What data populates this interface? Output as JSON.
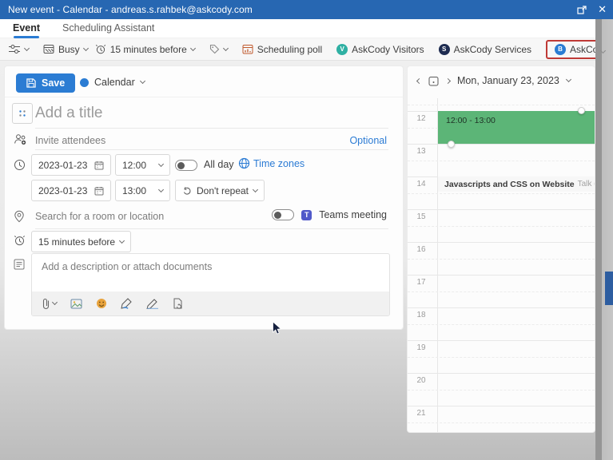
{
  "titlebar": {
    "title": "New event - Calendar - andreas.s.rahbek@askcody.com"
  },
  "tabs": {
    "event": "Event",
    "scheduling_assistant": "Scheduling Assistant"
  },
  "toolbar": {
    "busy": "Busy",
    "reminder": "15 minutes before",
    "scheduling_poll": "Scheduling poll",
    "visitors": "AskCody Visitors",
    "visitors_initial": "V",
    "services": "AskCody Services",
    "services_initial": "S",
    "bookings": "AskCody Bookings",
    "bookings_initial": "B",
    "more": "…"
  },
  "form": {
    "save": "Save",
    "calendar": "Calendar",
    "title_placeholder": "Add a title",
    "attendees_placeholder": "Invite attendees",
    "optional": "Optional",
    "start_date": "2023-01-23",
    "start_time": "12:00",
    "all_day": "All day",
    "time_zones": "Time zones",
    "end_date": "2023-01-23",
    "end_time": "13:00",
    "repeat": "Don't repeat",
    "location_placeholder": "Search for a room or location",
    "teams_meeting": "Teams meeting",
    "teams_initial": "T",
    "reminder_value": "15 minutes before",
    "description_placeholder": "Add a description or attach documents"
  },
  "calendar_panel": {
    "date_label": "Mon, January 23, 2023",
    "hours": [
      "12",
      "13",
      "14",
      "15",
      "16",
      "17",
      "18",
      "19",
      "20",
      "21"
    ],
    "selected_event": {
      "time_label": "12:00 - 13:00"
    },
    "other_event": {
      "title": "Javascripts and CSS on Website",
      "details": "Talk (Aalbor"
    }
  },
  "icons": {
    "titlebar": [
      "popout-icon",
      "close-icon"
    ],
    "toolbar": [
      "response-options-icon",
      "busy-calendar-icon",
      "alarm-icon",
      "tag-icon",
      "scheduling-poll-icon",
      "askcody-visitors-icon",
      "askcody-services-icon",
      "askcody-bookings-icon"
    ],
    "form": [
      "save-icon",
      "calendar-color-dot",
      "event-emoji-icon",
      "attendees-icon",
      "clock-icon",
      "date-picker-icon",
      "repeat-icon",
      "globe-icon",
      "location-pin-icon",
      "teams-icon",
      "reminder-alarm-icon",
      "description-icon",
      "attach-icon",
      "image-icon",
      "emoji-icon",
      "draw-icon",
      "signature-icon",
      "insert-document-icon"
    ],
    "panel": [
      "chevron-left-icon",
      "today-icon",
      "chevron-right-icon",
      "chevron-down-icon"
    ]
  },
  "colors": {
    "titlebar": "#2767b2",
    "accent": "#2b7cd3",
    "link": "#2b7bd4",
    "event_green": "#5cb577",
    "highlight_red": "#bf3a36",
    "visitors_teal": "#2fb0a3",
    "services_navy": "#1d2b50",
    "teams_purple": "#5059c9"
  }
}
